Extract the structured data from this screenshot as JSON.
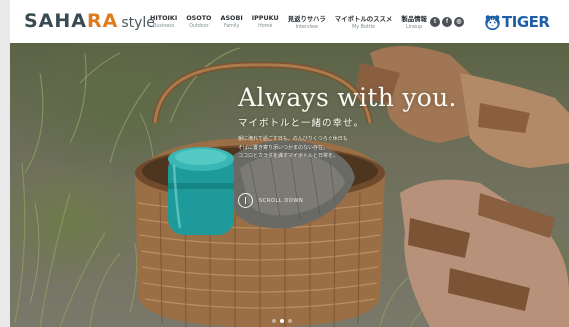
{
  "brand": {
    "logo_main_a": "SAHA",
    "logo_main_b": "RA",
    "logo_sub": "style",
    "accent_color": "#e07a1f"
  },
  "nav": {
    "items": [
      {
        "title": "HITOIKI",
        "sub": "Business"
      },
      {
        "title": "OSOTO",
        "sub": "Outdoor"
      },
      {
        "title": "ASOBI",
        "sub": "Family"
      },
      {
        "title": "IPPUKU",
        "sub": "Home"
      },
      {
        "title": "見返りサハラ",
        "sub": "Interview"
      },
      {
        "title": "マイボトルのススメ",
        "sub": "My Bottle"
      },
      {
        "title": "製品情報",
        "sub": "Lineup"
      }
    ]
  },
  "social": {
    "icons": [
      "twitter-icon",
      "facebook-icon",
      "instagram-icon"
    ],
    "glyphs": [
      "t",
      "f",
      "◎"
    ]
  },
  "corp": {
    "name": "TIGER",
    "color": "#1f5fa8"
  },
  "hero": {
    "headline": "Always with you.",
    "subline": "マイボトルと一緒の幸せ。",
    "lead": [
      "朝に淹れて過ごす日も、のんびりくつろぐ休日も",
      "そばに置き寄り添いつかまのない存在。",
      "ココロとカラダを満すマイボトルと日常を。"
    ],
    "scroll_label": "SCROLL DOWN",
    "slide_count": 3,
    "active_slide": 1
  }
}
